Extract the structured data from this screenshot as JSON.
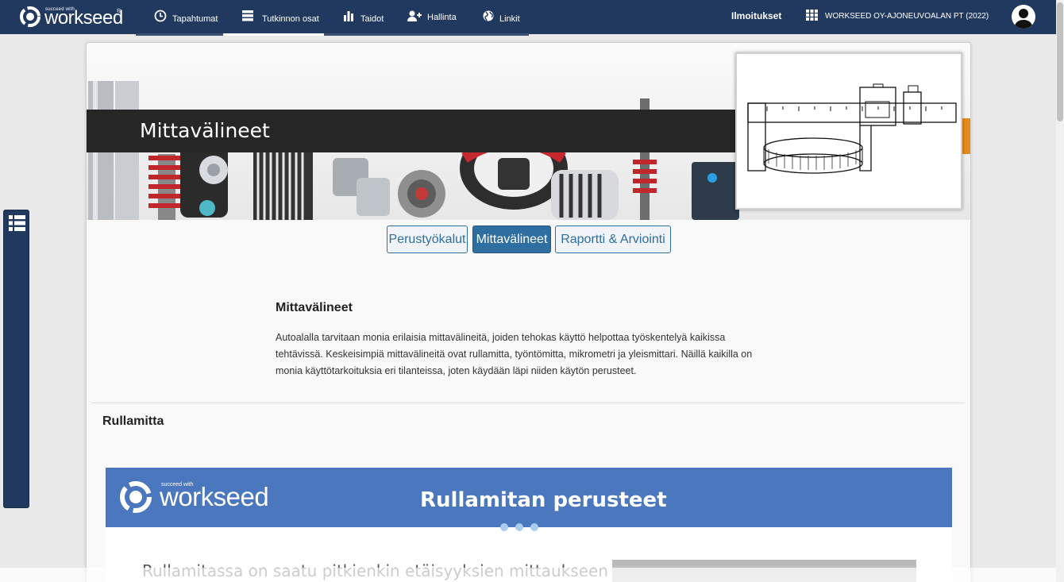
{
  "app": {
    "logo_tagline": "succeed with",
    "logo_text": "workseed",
    "logo_reg": "®"
  },
  "nav": {
    "items": [
      {
        "label": "Tapahtumat",
        "icon": "clock-icon"
      },
      {
        "label": "Tutkinnon osat",
        "icon": "server-icon"
      },
      {
        "label": "Taidot",
        "icon": "bar-chart-icon"
      },
      {
        "label": "Hallinta",
        "icon": "user-add-icon"
      },
      {
        "label": "Linkit",
        "icon": "globe-icon"
      }
    ],
    "active_index": 1,
    "notifications_label": "Ilmoitukset",
    "organization": "WORKSEED OY-AJONEUVOALAN PT (2022)"
  },
  "banner": {
    "title": "Mittavälineet"
  },
  "tabs": [
    {
      "label": "Perustyökalut",
      "active": false
    },
    {
      "label": "Mittavälineet",
      "active": true
    },
    {
      "label": "Raportti & Arviointi",
      "active": false
    }
  ],
  "section": {
    "heading": "Mittavälineet",
    "body": "Autoalalla tarvitaan monia erilaisia mittavälineitä, joiden tehokas käyttö helpottaa työskentelyä kaikissa tehtävissä. Keskeisimpiä mittavälineitä ovat rullamitta, työntömitta, mikrometri ja yleismittari. Näillä kaikilla on monia käyttötarkoituksia eri tilanteissa, joten käydään läpi niiden käytön perusteet."
  },
  "subsection": {
    "heading": "Rullamitta"
  },
  "embed": {
    "logo_tagline": "succeed with",
    "logo_text": "workseed",
    "title": "Rullamitan perusteet",
    "intro_line": "Rullamitassa on saatu pitkienkin etäisyyksien mittaukseen"
  },
  "colors": {
    "nav_bg": "#22395f",
    "accent": "#2f6ea0",
    "embed_header": "#4a77bd"
  }
}
